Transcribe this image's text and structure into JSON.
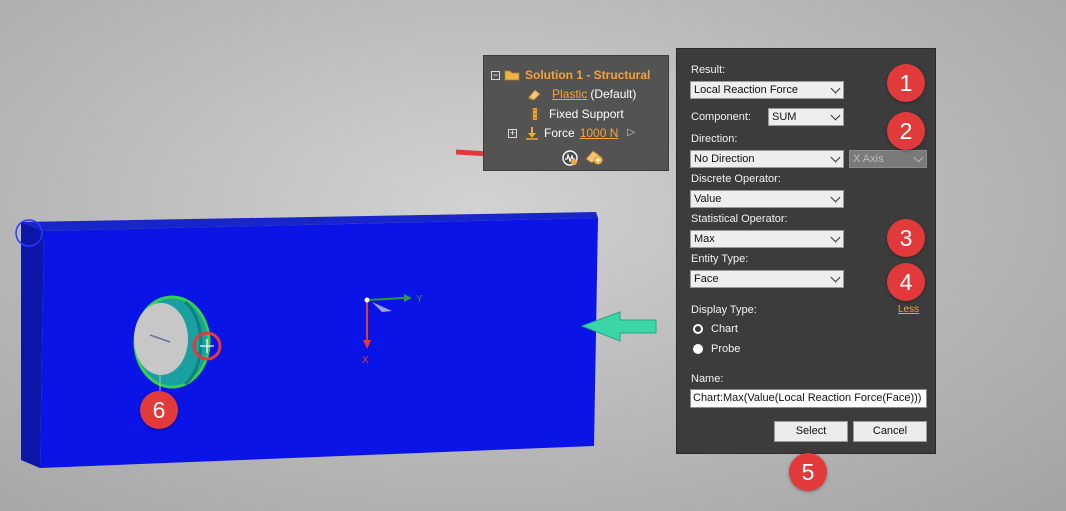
{
  "colors": {
    "callout": "#e23a3a",
    "accent_link": "#f4a23a",
    "model_body": "#0a14e6",
    "dialog_bg": "#3c3c3c"
  },
  "tree": {
    "solution_title": "Solution 1 - Structural",
    "material_link": "Plastic",
    "material_suffix": "(Default)",
    "fixed_support": "Fixed Support",
    "force_label": "Force",
    "force_value": "1000 N",
    "expander_collapse": "−",
    "expander_expand": "+",
    "play_icon": "▷"
  },
  "viewport": {
    "axis_y": "Y",
    "axis_x": "X"
  },
  "dialog": {
    "result_label": "Result:",
    "result_value": "Local Reaction Force",
    "component_label": "Component:",
    "component_value": "SUM",
    "direction_label": "Direction:",
    "direction_value": "No Direction",
    "axis_value": "X Axis",
    "discrete_label": "Discrete Operator:",
    "discrete_value": "Value",
    "statistical_label": "Statistical Operator:",
    "statistical_value": "Max",
    "entity_label": "Entity Type:",
    "entity_value": "Face",
    "less_link": "Less",
    "display_type_label": "Display Type:",
    "display_options": [
      "Chart",
      "Probe"
    ],
    "display_selected": "Chart",
    "name_label": "Name:",
    "name_value": "Chart:Max(Value(Local Reaction Force(Face)))",
    "select_button": "Select",
    "cancel_button": "Cancel"
  },
  "callouts": [
    "1",
    "2",
    "3",
    "4",
    "5",
    "6"
  ]
}
